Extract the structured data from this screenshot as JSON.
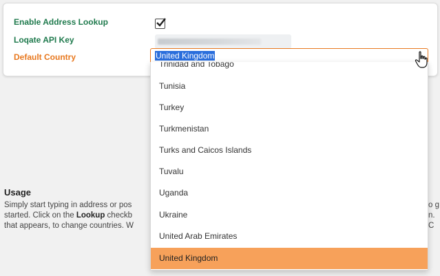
{
  "settings": {
    "enable_lookup_label": "Enable Address Lookup",
    "enable_lookup_checked": true,
    "api_key_label": "Loqate API Key",
    "default_country_label": "Default Country",
    "default_country_value": "United Kingdom"
  },
  "dropdown": {
    "options": [
      "Trinidad and Tobago",
      "Tunisia",
      "Turkey",
      "Turkmenistan",
      "Turks and Caicos Islands",
      "Tuvalu",
      "Uganda",
      "Ukraine",
      "United Arab Emirates",
      "United Kingdom"
    ],
    "highlighted": "United Kingdom"
  },
  "usage": {
    "title": "Usage",
    "line1": "Simply start typing in address or pos",
    "line2_pre": "started. Click on the ",
    "line2_bold": "Lookup",
    "line2_post": " checkb",
    "line3": "that appears, to change countries. W",
    "tail1": "o g",
    "tail2": "n. C"
  },
  "colors": {
    "label_green": "#1f7a4d",
    "label_orange": "#e8781e",
    "highlight": "#f7a15a",
    "selection_blue": "#2a6edc"
  }
}
